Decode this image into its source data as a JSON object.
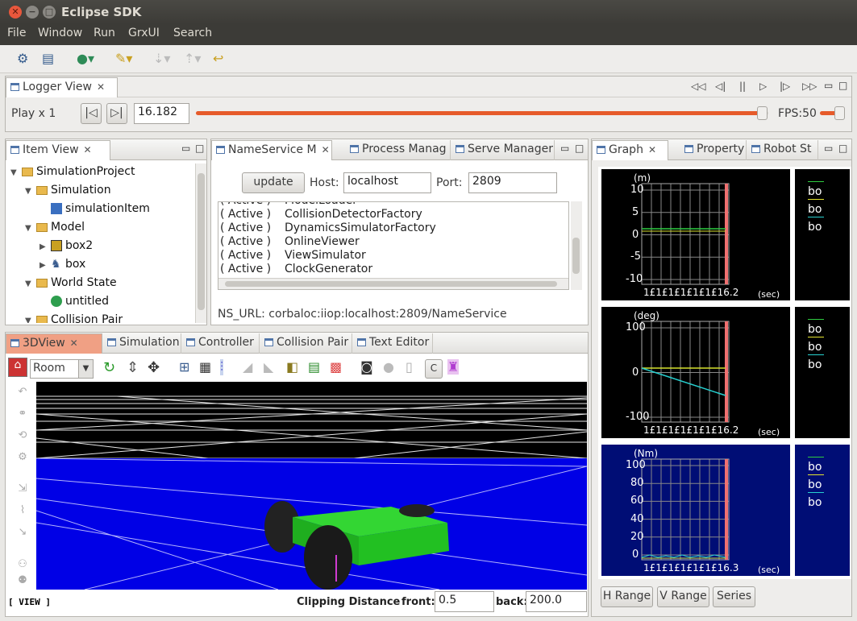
{
  "window": {
    "title": "Eclipse SDK"
  },
  "menu": {
    "items": [
      "File",
      "Window",
      "Run",
      "GrxUI",
      "Search"
    ]
  },
  "logger": {
    "tab": "Logger View",
    "play_label": "Play x 1",
    "time_value": "16.182",
    "fps_label": "FPS:50",
    "progress": 0.99
  },
  "item_view": {
    "tab": "Item View",
    "tree": [
      {
        "label": "SimulationProject",
        "depth": 0,
        "toggle": "▼",
        "icon": "folder"
      },
      {
        "label": "Simulation",
        "depth": 1,
        "toggle": "▼",
        "icon": "folder"
      },
      {
        "label": "simulationItem",
        "depth": 2,
        "toggle": "",
        "icon": "sim"
      },
      {
        "label": "Model",
        "depth": 1,
        "toggle": "▼",
        "icon": "folder"
      },
      {
        "label": "box2",
        "depth": 2,
        "toggle": "▶",
        "icon": "box"
      },
      {
        "label": "box",
        "depth": 2,
        "toggle": "▶",
        "icon": "robot"
      },
      {
        "label": "World State",
        "depth": 1,
        "toggle": "▼",
        "icon": "folder"
      },
      {
        "label": "untitled",
        "depth": 2,
        "toggle": "",
        "icon": "globe"
      },
      {
        "label": "Collision Pair",
        "depth": 1,
        "toggle": "▼",
        "icon": "folder"
      }
    ]
  },
  "nameservice": {
    "tabs": [
      "NameService M",
      "Process Manag",
      "Serve Manager"
    ],
    "update_label": "update",
    "host_label": "Host:",
    "host_value": "localhost",
    "port_label": "Port:",
    "port_value": "2809",
    "services": [
      {
        "status": "Active",
        "name": "ModelLoader"
      },
      {
        "status": "Active",
        "name": "CollisionDetectorFactory"
      },
      {
        "status": "Active",
        "name": "DynamicsSimulatorFactory"
      },
      {
        "status": "Active",
        "name": "OnlineViewer"
      },
      {
        "status": "Active",
        "name": "ViewSimulator"
      },
      {
        "status": "Active",
        "name": "ClockGenerator"
      }
    ],
    "ns_url": "NS_URL: corbaloc:iiop:localhost:2809/NameService"
  },
  "graph": {
    "tabs": [
      "Graph",
      "Property",
      "Robot St"
    ],
    "plots": [
      {
        "unit": "(m)",
        "ticks": [
          "10",
          "5",
          "0",
          "-5",
          "-10"
        ],
        "xtick": "1£1£1£1£1£1£16.2",
        "xunit": "(sec)",
        "legend": [
          "bo",
          "bo",
          "bo"
        ],
        "legend_colors": [
          "#2ecc40",
          "#e5e52e",
          "#27d0d0"
        ]
      },
      {
        "unit": "(deg)",
        "ticks": [
          "100",
          "0",
          "-100"
        ],
        "xtick": "1£1£1£1£1£1£16.2",
        "xunit": "(sec)",
        "legend": [
          "bo",
          "bo",
          "bo"
        ],
        "legend_colors": [
          "#2ecc40",
          "#e5e52e",
          "#27d0d0"
        ]
      },
      {
        "unit": "(Nm)",
        "ticks": [
          "100",
          "80",
          "60",
          "40",
          "20",
          "0"
        ],
        "xtick": "1£1£1£1£1£1£16.3",
        "xunit": "(sec)",
        "legend": [
          "bo",
          "bo",
          "bo"
        ],
        "legend_colors": [
          "#2ecc40",
          "#e5e52e",
          "#27d0d0"
        ]
      }
    ],
    "buttons": [
      "H Range",
      "V Range",
      "Series"
    ]
  },
  "view3d": {
    "tabs": [
      "3DView",
      "Simulation",
      "Controller",
      "Collision Pair",
      "Text Editor"
    ],
    "camera_select": "Room",
    "mode_label": "[ VIEW ]",
    "clip_label": "Clipping Distance",
    "front_label": "front:",
    "front_value": "0.5",
    "back_label": "back:",
    "back_value": "200.0",
    "c_button": "C"
  }
}
